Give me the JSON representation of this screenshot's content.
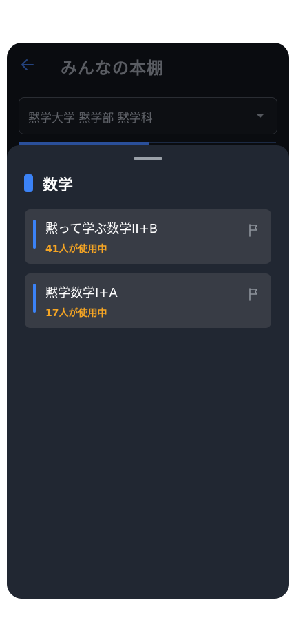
{
  "header": {
    "back_icon": "arrow-left-icon",
    "title": "みんなの本棚"
  },
  "filter": {
    "selected": "黙学大学 黙学部 黙学科",
    "caret_icon": "caret-down-icon"
  },
  "sheet": {
    "section_title": "数学",
    "items": [
      {
        "title": "黙って学ぶ数学II+B",
        "usage": "41人が使用中",
        "flag_icon": "flag-icon"
      },
      {
        "title": "黙学数学I+A",
        "usage": "17人が使用中",
        "flag_icon": "flag-icon"
      }
    ]
  },
  "colors": {
    "accent": "#3b82f6",
    "usage_text": "#f5a524",
    "sheet_bg": "#212732",
    "card_bg": "#383c45"
  }
}
